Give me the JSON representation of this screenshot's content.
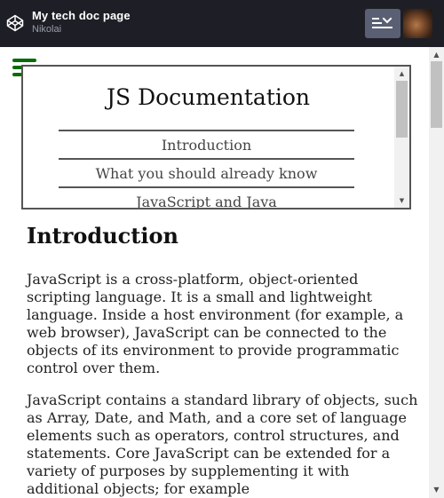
{
  "header": {
    "title": "My tech doc page",
    "author": "Nikolai",
    "logo_icon": "codepen-icon",
    "view_button_icon": "view-toggle-icon",
    "colors": {
      "bar": "#1e1f26",
      "button": "#5a5f73"
    }
  },
  "nav": {
    "title": "JS Documentation",
    "links": [
      {
        "label": "Introduction"
      },
      {
        "label": "What you should already know"
      },
      {
        "label": "JavaScript and Java"
      }
    ]
  },
  "main": {
    "section_title": "Introduction",
    "paragraphs": [
      "JavaScript is a cross-platform, object-oriented scripting language. It is a small and lightweight language. Inside a host environment (for example, a web browser), JavaScript can be connected to the objects of its environment to provide programmatic control over them.",
      "JavaScript contains a standard library of objects, such as Array, Date, and Math, and a core set of language elements such as operators, control structures, and statements. Core JavaScript can be extended for a variety of purposes by supplementing it with additional objects; for example"
    ]
  },
  "menu_icon_color": "#0a6b0a"
}
